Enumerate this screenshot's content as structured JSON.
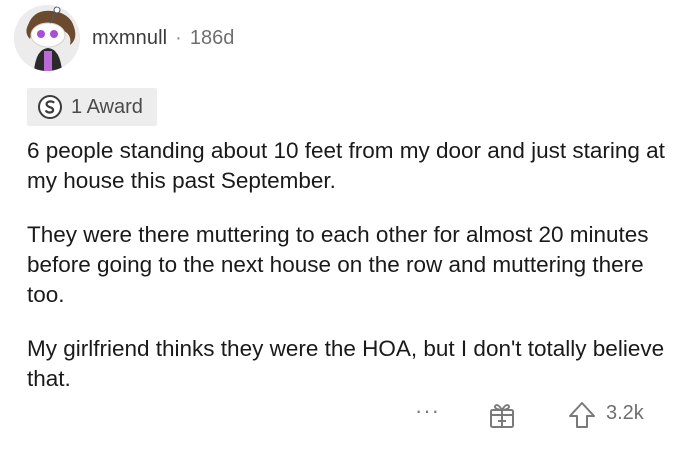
{
  "comment": {
    "author": "mxmnull",
    "separator": "·",
    "age": "186d",
    "award": {
      "icon": "silver-award-icon",
      "label": "1 Award"
    },
    "paragraphs": [
      "6 people standing about 10 feet from my door and just staring at my house this past September.",
      "They were there muttering to each other for almost 20 minutes before going to the next house on the row and muttering there too.",
      "My girlfriend thinks they were the HOA, but I don't totally believe that."
    ],
    "actions": {
      "more": "···",
      "gift_icon": "gift-icon",
      "upvote_icon": "upvote-arrow-icon",
      "score": "3.2k"
    }
  }
}
